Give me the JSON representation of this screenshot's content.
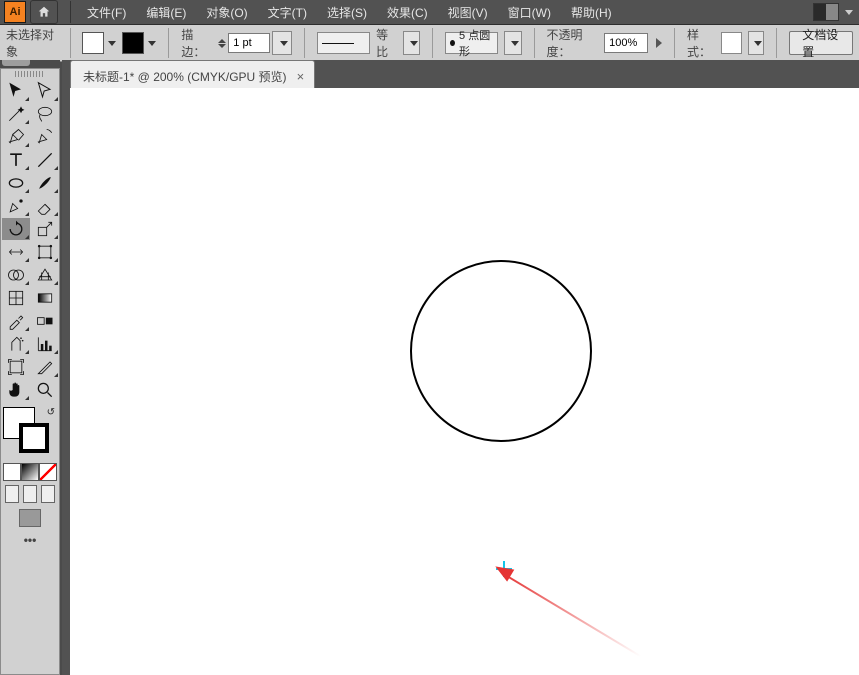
{
  "menu": {
    "file": "文件(F)",
    "edit": "编辑(E)",
    "object": "对象(O)",
    "text": "文字(T)",
    "select": "选择(S)",
    "effect": "效果(C)",
    "view": "视图(V)",
    "window": "窗口(W)",
    "help": "帮助(H)"
  },
  "options": {
    "no_selection": "未选择对象",
    "stroke_label": "描边：",
    "stroke_pt": "1 pt",
    "uniform_label": "等比",
    "brush_label": "5 点圆形",
    "opacity_label": "不透明度：",
    "opacity_value": "100%",
    "style_label": "样式：",
    "doc_setup": "文档设置"
  },
  "tab": {
    "title": "未标题-1* @ 200% (CMYK/GPU 预览)"
  },
  "tools": {
    "selection": "selection-tool",
    "direct_selection": "direct-selection-tool",
    "magic_wand": "magic-wand-tool",
    "lasso": "lasso-tool",
    "pen": "pen-tool",
    "curvature": "curvature-tool",
    "type": "type-tool",
    "line": "line-segment-tool",
    "ellipse": "ellipse-tool",
    "brush": "paintbrush-tool",
    "shaper": "shaper-tool",
    "eraser": "eraser-tool",
    "rotate": "rotate-tool",
    "scale": "scale-tool",
    "width": "width-tool",
    "free_transform": "free-transform-tool",
    "shape_builder": "shape-builder-tool",
    "perspective": "perspective-grid-tool",
    "mesh": "mesh-tool",
    "gradient": "gradient-tool",
    "eyedropper": "eyedropper-tool",
    "blend": "blend-tool",
    "symbol_sprayer": "symbol-sprayer-tool",
    "column_graph": "column-graph-tool",
    "artboard": "artboard-tool",
    "slice": "slice-tool",
    "hand": "hand-tool",
    "zoom": "zoom-tool"
  }
}
